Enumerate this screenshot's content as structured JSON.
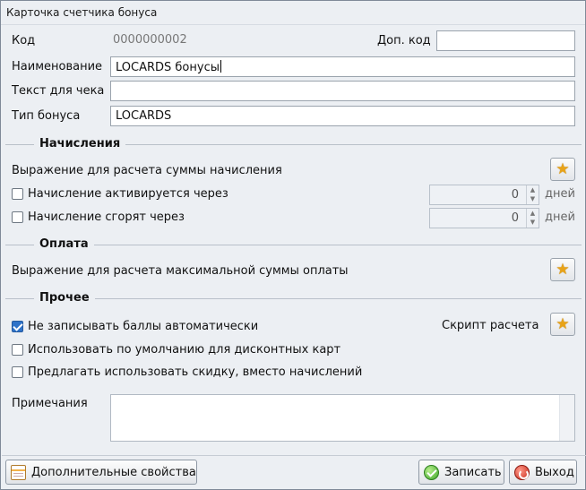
{
  "window": {
    "title": "Карточка счетчика бонуса"
  },
  "fields": {
    "code_label": "Код",
    "code_value": "0000000002",
    "extra_code_label": "Доп. код",
    "extra_code_value": "",
    "name_label": "Наименование",
    "name_value": "LOCARDS бонусы",
    "receipt_text_label": "Текст для чека",
    "receipt_text_value": "",
    "bonus_type_label": "Тип бонуса",
    "bonus_type_value": "LOCARDS"
  },
  "accruals": {
    "title": "Начисления",
    "expression_label": "Выражение для расчета суммы начисления",
    "activate": {
      "label": "Начисление активируется через",
      "checked": false,
      "value": "0",
      "unit": "дней"
    },
    "expire": {
      "label": "Начисление сгорят  через",
      "checked": false,
      "value": "0",
      "unit": "дней"
    }
  },
  "payment": {
    "title": "Оплата",
    "expression_label": "Выражение для расчета максимальной суммы оплаты"
  },
  "other": {
    "title": "Прочее",
    "no_auto_points": {
      "label": "Не записывать баллы автоматически",
      "checked": true
    },
    "script_label": "Скрипт расчета",
    "default_discount_cards": {
      "label": "Использовать по умолчанию для дисконтных карт",
      "checked": false
    },
    "offer_discount": {
      "label": "Предлагать использовать скидку, вместо начислений",
      "checked": false
    }
  },
  "notes": {
    "label": "Примечания",
    "value": ""
  },
  "footer": {
    "extra_props_label": "Дополнительные свойства",
    "save_label": "Записать",
    "exit_label": "Выход"
  },
  "icons": {
    "star": "star-icon",
    "props": "properties-icon",
    "ok": "check-circle-icon",
    "exit": "power-icon"
  },
  "colors": {
    "window_bg": "#eceff3",
    "checkbox_checked": "#2f73c9",
    "star": "#e8a317"
  }
}
